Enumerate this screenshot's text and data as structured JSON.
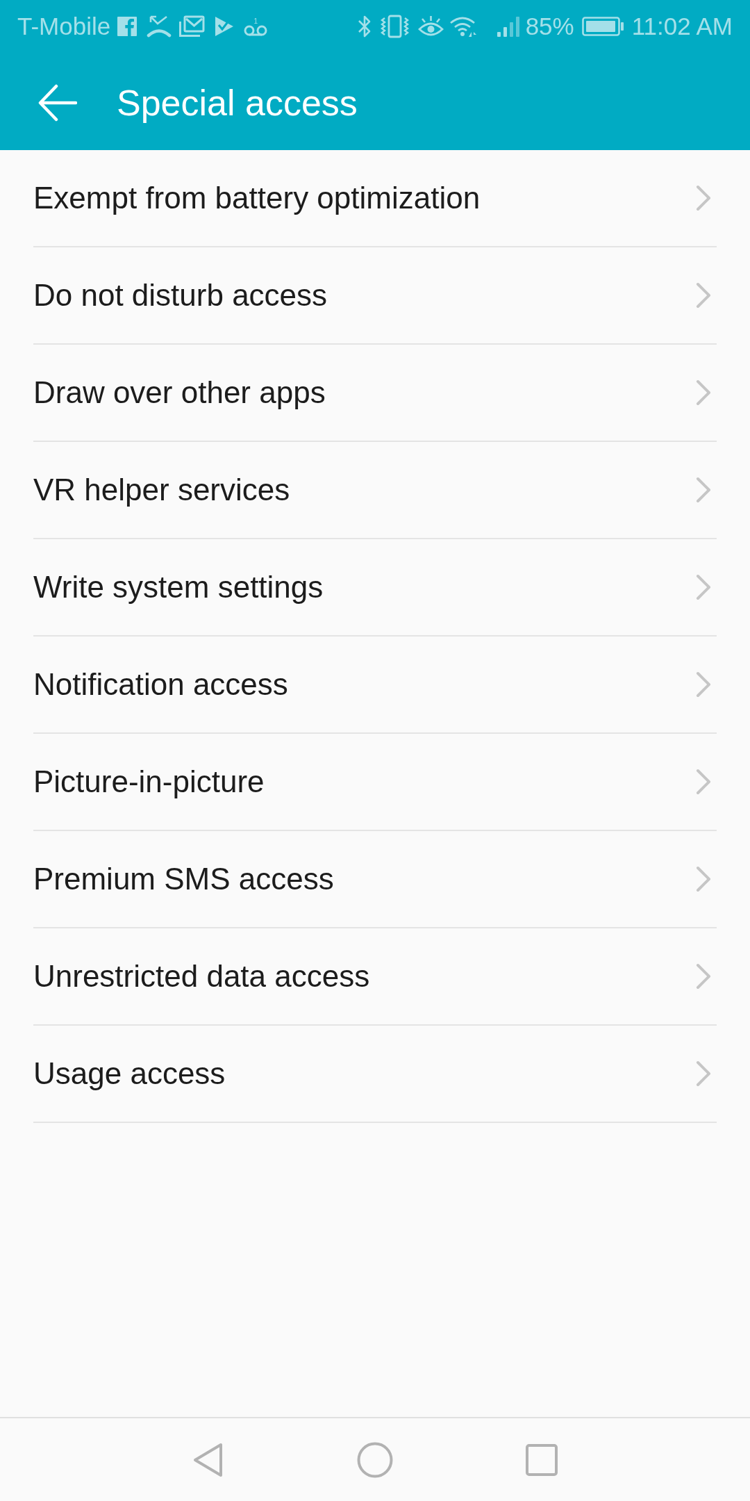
{
  "status_bar": {
    "carrier": "T-Mobile",
    "voicemail_count": "1",
    "battery": "85%",
    "time": "11:02 AM"
  },
  "app_bar": {
    "title": "Special access"
  },
  "items": [
    {
      "label": "Exempt from battery optimization"
    },
    {
      "label": "Do not disturb access"
    },
    {
      "label": "Draw over other apps"
    },
    {
      "label": "VR helper services"
    },
    {
      "label": "Write system settings"
    },
    {
      "label": "Notification access"
    },
    {
      "label": "Picture-in-picture"
    },
    {
      "label": "Premium SMS access"
    },
    {
      "label": "Unrestricted data access"
    },
    {
      "label": "Usage access"
    }
  ]
}
